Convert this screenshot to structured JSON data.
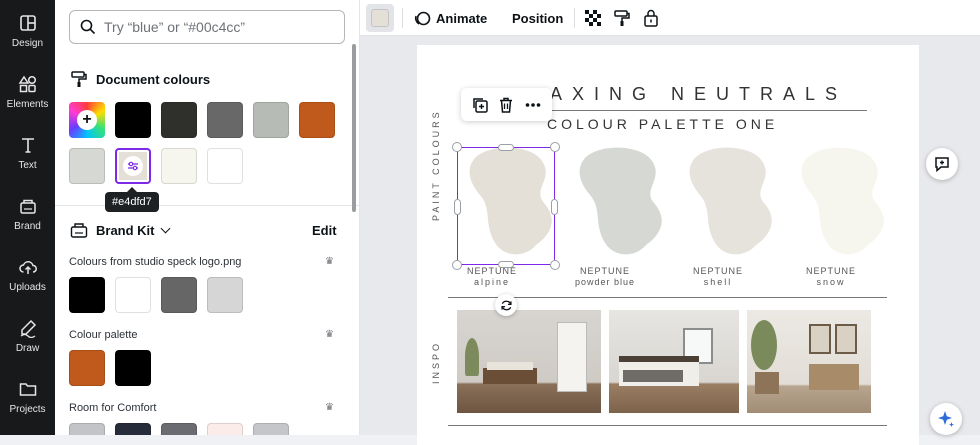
{
  "rail": {
    "items": [
      {
        "label": "Design",
        "icon": "layout-icon"
      },
      {
        "label": "Elements",
        "icon": "shapes-icon"
      },
      {
        "label": "Text",
        "icon": "text-icon"
      },
      {
        "label": "Brand",
        "icon": "brand-icon"
      },
      {
        "label": "Uploads",
        "icon": "cloud-upload-icon"
      },
      {
        "label": "Draw",
        "icon": "pen-icon"
      },
      {
        "label": "Projects",
        "icon": "folder-icon"
      }
    ]
  },
  "panel": {
    "search_placeholder": "Try “blue” or “#00c4cc”",
    "document_colours_title": "Document colours",
    "document_colours": [
      "#000000",
      "#2f302b",
      "#686868",
      "#b6bbb6",
      "#c05a1c",
      "#d5d8d3",
      "#e4dfd7",
      "#f6f6ee",
      "#ffffff"
    ],
    "tooltip": "#e4dfd7",
    "brand_kit_title": "Brand Kit",
    "edit_label": "Edit",
    "groups": [
      {
        "title": "Colours from studio speck logo.png",
        "colours": [
          "#000000",
          "#ffffff",
          "#666666",
          "#d6d6d6"
        ]
      },
      {
        "title": "Colour palette",
        "colours": [
          "#c05a1c",
          "#000000"
        ]
      },
      {
        "title": "Room for Comfort",
        "colours": [
          "#c3c4c8",
          "#262c3a",
          "#6a6c72",
          "#fbecea",
          "#c5c6ca"
        ]
      }
    ]
  },
  "toolbar": {
    "color_swatch": "#e4dfd7",
    "animate_label": "Animate",
    "position_label": "Position"
  },
  "poster": {
    "title_line1": "AXING NEUTRALS",
    "title_line2": "COLOUR PALETTE ONE",
    "paint_colours_label": "PAINT COLOURS",
    "inspo_label": "INSPO",
    "paints": [
      {
        "brand": "NEPTUNE",
        "name": "alpine",
        "color": "#e4dfd7"
      },
      {
        "brand": "NEPTUNE",
        "name": "powder blue",
        "color": "#d5d8d3"
      },
      {
        "brand": "NEPTUNE",
        "name": "shell",
        "color": "#e6e2dc"
      },
      {
        "brand": "NEPTUNE",
        "name": "snow",
        "color": "#f6f6ee"
      }
    ]
  },
  "accent": "#7d2ae8"
}
